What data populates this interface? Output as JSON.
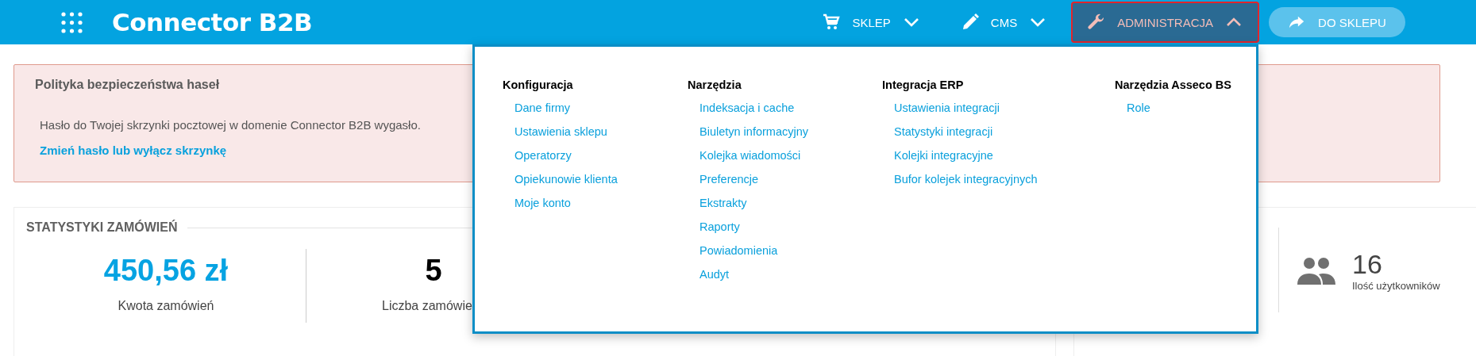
{
  "header": {
    "logo": "Connector B2B",
    "nav": [
      {
        "label": "SKLEP",
        "selected": false,
        "expanded": false
      },
      {
        "label": "CMS",
        "selected": false,
        "expanded": false
      },
      {
        "label": "ADMINISTRACJA",
        "selected": true,
        "expanded": true
      }
    ],
    "shop_button": "DO SKLEPU"
  },
  "alert": {
    "title": "Polityka bezpieczeństwa haseł",
    "message": "Hasło do Twojej skrzynki pocztowej w domenie Connector B2B wygasło.",
    "link": "Zmień hasło lub wyłącz skrzynkę"
  },
  "order_stats": {
    "title": "STATYSTYKI ZAMÓWIEŃ",
    "items": [
      {
        "value": "450,56 zł",
        "label": "Kwota zamówień",
        "color": "#06a3e2"
      },
      {
        "value": "5",
        "label": "Liczba zamówie",
        "color": "#000000"
      }
    ]
  },
  "user_stats": {
    "value": "16",
    "label": "Ilość użytkowników"
  },
  "admin_menu": {
    "columns": [
      {
        "heading": "Konfiguracja",
        "items": [
          "Dane firmy",
          "Ustawienia sklepu",
          "Operatorzy",
          "Opiekunowie klienta",
          "Moje konto"
        ]
      },
      {
        "heading": "Narzędzia",
        "items": [
          "Indeksacja i cache",
          "Biuletyn informacyjny",
          "Kolejka wiadomości",
          "Preferencje",
          "Ekstrakty",
          "Raporty",
          "Powiadomienia",
          "Audyt"
        ]
      },
      {
        "heading": "Integracja ERP",
        "items": [
          "Ustawienia integracji",
          "Statystyki integracji",
          "Kolejki integracyjne",
          "Bufor kolejek integracyjnych"
        ]
      },
      {
        "heading": "Narzędzia Asseco BS",
        "items": [
          "Role"
        ]
      }
    ]
  }
}
